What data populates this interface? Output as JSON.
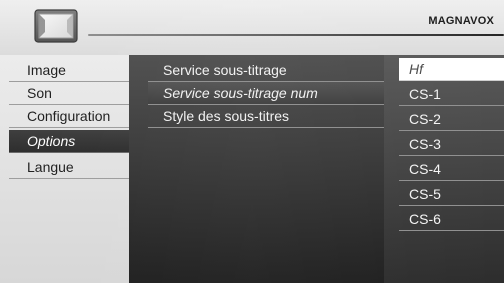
{
  "brand": "MAGNAVOX",
  "left_menu": [
    {
      "label": "Image",
      "selected": false
    },
    {
      "label": "Son",
      "selected": false
    },
    {
      "label": "Configuration",
      "selected": false
    },
    {
      "label": "Options",
      "selected": true
    },
    {
      "label": "Langue",
      "selected": false
    }
  ],
  "middle_menu": [
    {
      "label": "Service sous-titrage",
      "selected": false
    },
    {
      "label": "Service sous-titrage num",
      "selected": true
    },
    {
      "label": "Style des sous-titres",
      "selected": false
    }
  ],
  "right_menu": [
    {
      "label": "Hf",
      "active": true
    },
    {
      "label": "CS-1",
      "active": false
    },
    {
      "label": "CS-2",
      "active": false
    },
    {
      "label": "CS-3",
      "active": false
    },
    {
      "label": "CS-4",
      "active": false
    },
    {
      "label": "CS-5",
      "active": false
    },
    {
      "label": "CS-6",
      "active": false
    }
  ],
  "icons": {
    "tv": "tv-icon"
  }
}
